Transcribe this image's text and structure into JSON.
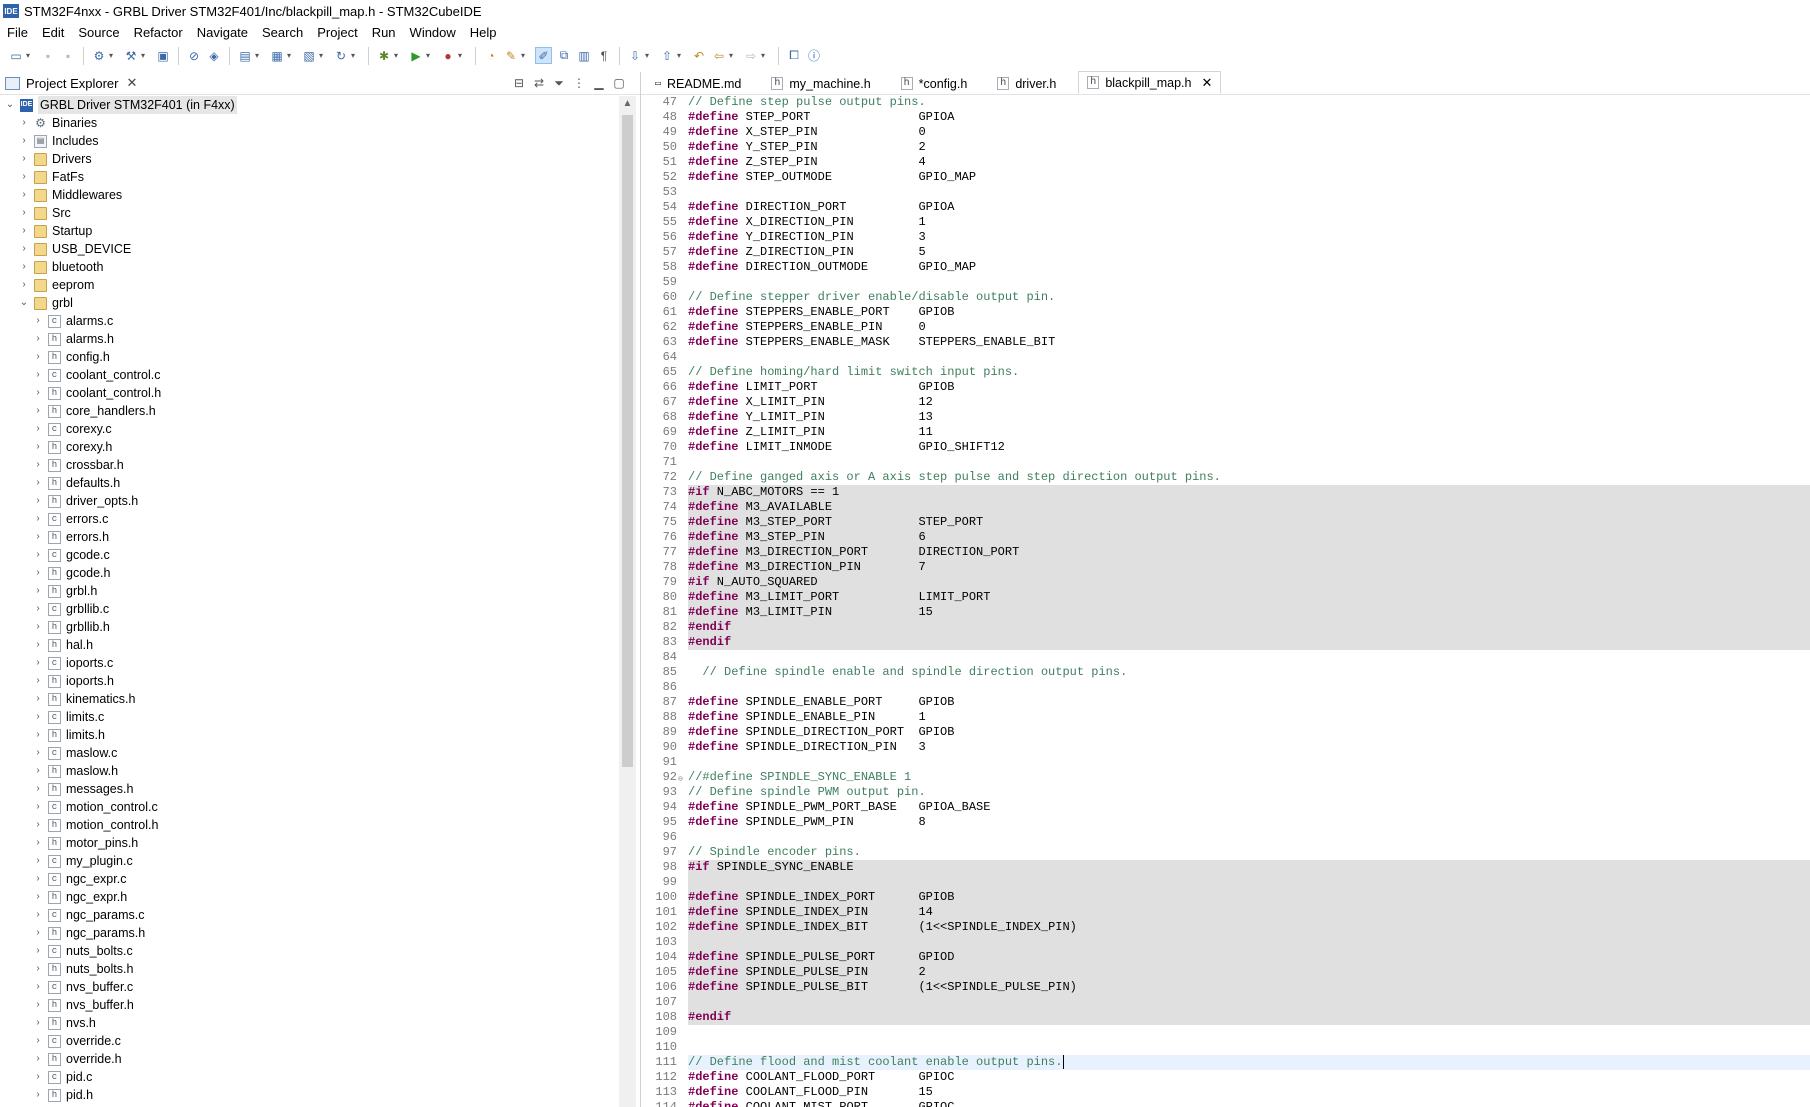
{
  "window": {
    "title": "STM32F4nxx - GRBL Driver STM32F401/Inc/blackpill_map.h - STM32CubeIDE",
    "logo": "IDE"
  },
  "menu": [
    "File",
    "Edit",
    "Source",
    "Refactor",
    "Navigate",
    "Search",
    "Project",
    "Run",
    "Window",
    "Help"
  ],
  "explorer": {
    "tab_label": "Project Explorer",
    "project": "GRBL Driver STM32F401 (in F4xx)",
    "top_items": [
      {
        "label": "Binaries",
        "kind": "bin"
      },
      {
        "label": "Includes",
        "kind": "inc"
      },
      {
        "label": "Drivers",
        "kind": "folder"
      },
      {
        "label": "FatFs",
        "kind": "folder"
      },
      {
        "label": "Middlewares",
        "kind": "folder"
      },
      {
        "label": "Src",
        "kind": "folder"
      },
      {
        "label": "Startup",
        "kind": "folder"
      },
      {
        "label": "USB_DEVICE",
        "kind": "folder"
      },
      {
        "label": "bluetooth",
        "kind": "folder"
      },
      {
        "label": "eeprom",
        "kind": "folder"
      },
      {
        "label": "grbl",
        "kind": "folder",
        "expanded": true
      }
    ],
    "grbl_files": [
      "alarms.c",
      "alarms.h",
      "config.h",
      "coolant_control.c",
      "coolant_control.h",
      "core_handlers.h",
      "corexy.c",
      "corexy.h",
      "crossbar.h",
      "defaults.h",
      "driver_opts.h",
      "errors.c",
      "errors.h",
      "gcode.c",
      "gcode.h",
      "grbl.h",
      "grbllib.c",
      "grbllib.h",
      "hal.h",
      "ioports.c",
      "ioports.h",
      "kinematics.h",
      "limits.c",
      "limits.h",
      "maslow.c",
      "maslow.h",
      "messages.h",
      "motion_control.c",
      "motion_control.h",
      "motor_pins.h",
      "my_plugin.c",
      "ngc_expr.c",
      "ngc_expr.h",
      "ngc_params.c",
      "ngc_params.h",
      "nuts_bolts.c",
      "nuts_bolts.h",
      "nvs_buffer.c",
      "nvs_buffer.h",
      "nvs.h",
      "override.c",
      "override.h",
      "pid.c",
      "pid.h"
    ]
  },
  "editor": {
    "tabs": [
      {
        "label": "README.md",
        "icon": "md"
      },
      {
        "label": "my_machine.h",
        "icon": "h"
      },
      {
        "label": "*config.h",
        "icon": "h"
      },
      {
        "label": "driver.h",
        "icon": "h"
      },
      {
        "label": "blackpill_map.h",
        "icon": "h",
        "active": true
      }
    ],
    "lines": [
      {
        "n": "47",
        "t": "// Define step pulse output pins."
      },
      {
        "n": "48",
        "t": "#define STEP_PORT               GPIOA"
      },
      {
        "n": "49",
        "t": "#define X_STEP_PIN              0"
      },
      {
        "n": "50",
        "t": "#define Y_STEP_PIN              2"
      },
      {
        "n": "51",
        "t": "#define Z_STEP_PIN              4"
      },
      {
        "n": "52",
        "t": "#define STEP_OUTMODE            GPIO_MAP"
      },
      {
        "n": "53",
        "t": ""
      },
      {
        "n": "54",
        "t": "#define DIRECTION_PORT          GPIOA"
      },
      {
        "n": "55",
        "t": "#define X_DIRECTION_PIN         1"
      },
      {
        "n": "56",
        "t": "#define Y_DIRECTION_PIN         3"
      },
      {
        "n": "57",
        "t": "#define Z_DIRECTION_PIN         5"
      },
      {
        "n": "58",
        "t": "#define DIRECTION_OUTMODE       GPIO_MAP"
      },
      {
        "n": "59",
        "t": ""
      },
      {
        "n": "60",
        "t": "// Define stepper driver enable/disable output pin."
      },
      {
        "n": "61",
        "t": "#define STEPPERS_ENABLE_PORT    GPIOB"
      },
      {
        "n": "62",
        "t": "#define STEPPERS_ENABLE_PIN     0"
      },
      {
        "n": "63",
        "t": "#define STEPPERS_ENABLE_MASK    STEPPERS_ENABLE_BIT"
      },
      {
        "n": "64",
        "t": ""
      },
      {
        "n": "65",
        "t": "// Define homing/hard limit switch input pins."
      },
      {
        "n": "66",
        "t": "#define LIMIT_PORT              GPIOB"
      },
      {
        "n": "67",
        "t": "#define X_LIMIT_PIN             12"
      },
      {
        "n": "68",
        "t": "#define Y_LIMIT_PIN             13"
      },
      {
        "n": "69",
        "t": "#define Z_LIMIT_PIN             11"
      },
      {
        "n": "70",
        "t": "#define LIMIT_INMODE            GPIO_SHIFT12"
      },
      {
        "n": "71",
        "t": ""
      },
      {
        "n": "72",
        "t": "// Define ganged axis or A axis step pulse and step direction output pins."
      },
      {
        "n": "73",
        "t": "#if N_ABC_MOTORS == 1",
        "hl": true
      },
      {
        "n": "74",
        "t": "#define M3_AVAILABLE",
        "hl": true
      },
      {
        "n": "75",
        "t": "#define M3_STEP_PORT            STEP_PORT",
        "hl": true
      },
      {
        "n": "76",
        "t": "#define M3_STEP_PIN             6",
        "hl": true
      },
      {
        "n": "77",
        "t": "#define M3_DIRECTION_PORT       DIRECTION_PORT",
        "hl": true
      },
      {
        "n": "78",
        "t": "#define M3_DIRECTION_PIN        7",
        "hl": true
      },
      {
        "n": "79",
        "t": "#if N_AUTO_SQUARED",
        "hl": true
      },
      {
        "n": "80",
        "t": "#define M3_LIMIT_PORT           LIMIT_PORT",
        "hl": true
      },
      {
        "n": "81",
        "t": "#define M3_LIMIT_PIN            15",
        "hl": true
      },
      {
        "n": "82",
        "t": "#endif",
        "hl": true
      },
      {
        "n": "83",
        "t": "#endif",
        "hl": true
      },
      {
        "n": "84",
        "t": ""
      },
      {
        "n": "85",
        "t": "  // Define spindle enable and spindle direction output pins."
      },
      {
        "n": "86",
        "t": ""
      },
      {
        "n": "87",
        "t": "#define SPINDLE_ENABLE_PORT     GPIOB"
      },
      {
        "n": "88",
        "t": "#define SPINDLE_ENABLE_PIN      1"
      },
      {
        "n": "89",
        "t": "#define SPINDLE_DIRECTION_PORT  GPIOB"
      },
      {
        "n": "90",
        "t": "#define SPINDLE_DIRECTION_PIN   3"
      },
      {
        "n": "91",
        "t": ""
      },
      {
        "n": "92",
        "t": "//#define SPINDLE_SYNC_ENABLE 1",
        "fold": true
      },
      {
        "n": "93",
        "t": "// Define spindle PWM output pin."
      },
      {
        "n": "94",
        "t": "#define SPINDLE_PWM_PORT_BASE   GPIOA_BASE"
      },
      {
        "n": "95",
        "t": "#define SPINDLE_PWM_PIN         8"
      },
      {
        "n": "96",
        "t": ""
      },
      {
        "n": "97",
        "t": "// Spindle encoder pins."
      },
      {
        "n": "98",
        "t": "#if SPINDLE_SYNC_ENABLE",
        "hl": true
      },
      {
        "n": "99",
        "t": "",
        "hl": true
      },
      {
        "n": "100",
        "t": "#define SPINDLE_INDEX_PORT      GPIOB",
        "hl": true
      },
      {
        "n": "101",
        "t": "#define SPINDLE_INDEX_PIN       14",
        "hl": true
      },
      {
        "n": "102",
        "t": "#define SPINDLE_INDEX_BIT       (1<<SPINDLE_INDEX_PIN)",
        "hl": true
      },
      {
        "n": "103",
        "t": "",
        "hl": true
      },
      {
        "n": "104",
        "t": "#define SPINDLE_PULSE_PORT      GPIOD",
        "hl": true
      },
      {
        "n": "105",
        "t": "#define SPINDLE_PULSE_PIN       2",
        "hl": true
      },
      {
        "n": "106",
        "t": "#define SPINDLE_PULSE_BIT       (1<<SPINDLE_PULSE_PIN)",
        "hl": true
      },
      {
        "n": "107",
        "t": "",
        "hl": true
      },
      {
        "n": "108",
        "t": "#endif",
        "hl": true
      },
      {
        "n": "109",
        "t": ""
      },
      {
        "n": "110",
        "t": ""
      },
      {
        "n": "111",
        "t": "// Define flood and mist coolant enable output pins.",
        "cursor": true
      },
      {
        "n": "112",
        "t": "#define COOLANT_FLOOD_PORT      GPIOC"
      },
      {
        "n": "113",
        "t": "#define COOLANT_FLOOD_PIN       15"
      },
      {
        "n": "114",
        "t": "#define COOLANT_MIST_PORT       GPIOC"
      }
    ]
  }
}
